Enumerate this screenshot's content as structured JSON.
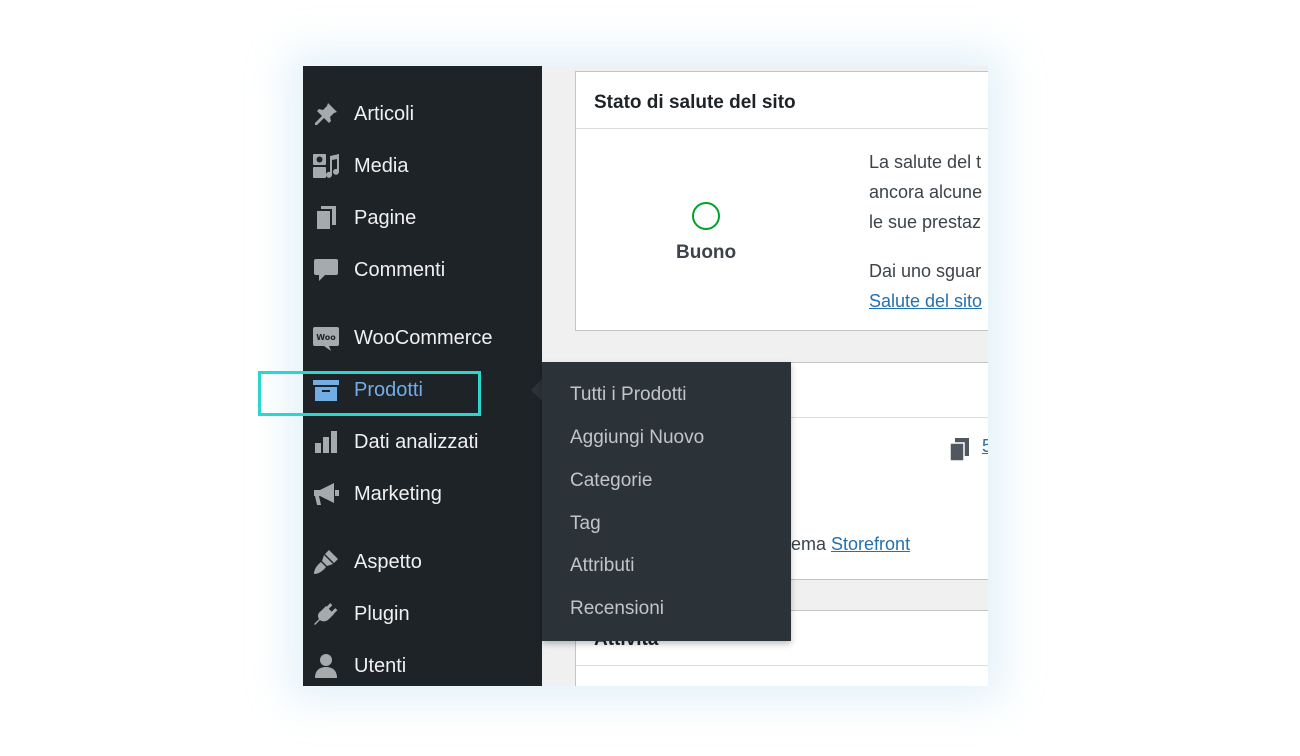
{
  "sidebar": {
    "items": [
      {
        "label": "Articoli",
        "icon": "pushpin-icon"
      },
      {
        "label": "Media",
        "icon": "media-icon"
      },
      {
        "label": "Pagine",
        "icon": "pages-icon"
      },
      {
        "label": "Commenti",
        "icon": "comment-icon"
      },
      {
        "label": "WooCommerce",
        "icon": "woo-icon"
      },
      {
        "label": "Prodotti",
        "icon": "archive-icon",
        "active": true
      },
      {
        "label": "Dati analizzati",
        "icon": "bar-chart-icon"
      },
      {
        "label": "Marketing",
        "icon": "megaphone-icon"
      },
      {
        "label": "Aspetto",
        "icon": "paintbrush-icon"
      },
      {
        "label": "Plugin",
        "icon": "plugin-icon"
      },
      {
        "label": "Utenti",
        "icon": "user-icon"
      }
    ],
    "woo_badge": "Woo"
  },
  "flyout": {
    "items": [
      "Tutti i Prodotti",
      "Aggiungi Nuovo",
      "Categorie",
      "Tag",
      "Attributi",
      "Recensioni"
    ]
  },
  "health_card": {
    "title": "Stato di salute del sito",
    "status": "Buono",
    "lines": [
      "La salute del t",
      "ancora alcune",
      "le sue prestaz"
    ],
    "line4": "Dai uno sguar",
    "link": "Salute del sito"
  },
  "glance_card": {
    "count_fragment": "5",
    "theme_prefix": "tema ",
    "theme_link": "Storefront"
  },
  "activity_card": {
    "title": "Attività"
  },
  "colors": {
    "sidebar_bg": "#1d2327",
    "flyout_bg": "#2c3338",
    "active_blue": "#72aee6",
    "link_blue": "#2271b1",
    "health_green": "#00a32a",
    "highlight_teal": "#2bd6cc"
  }
}
